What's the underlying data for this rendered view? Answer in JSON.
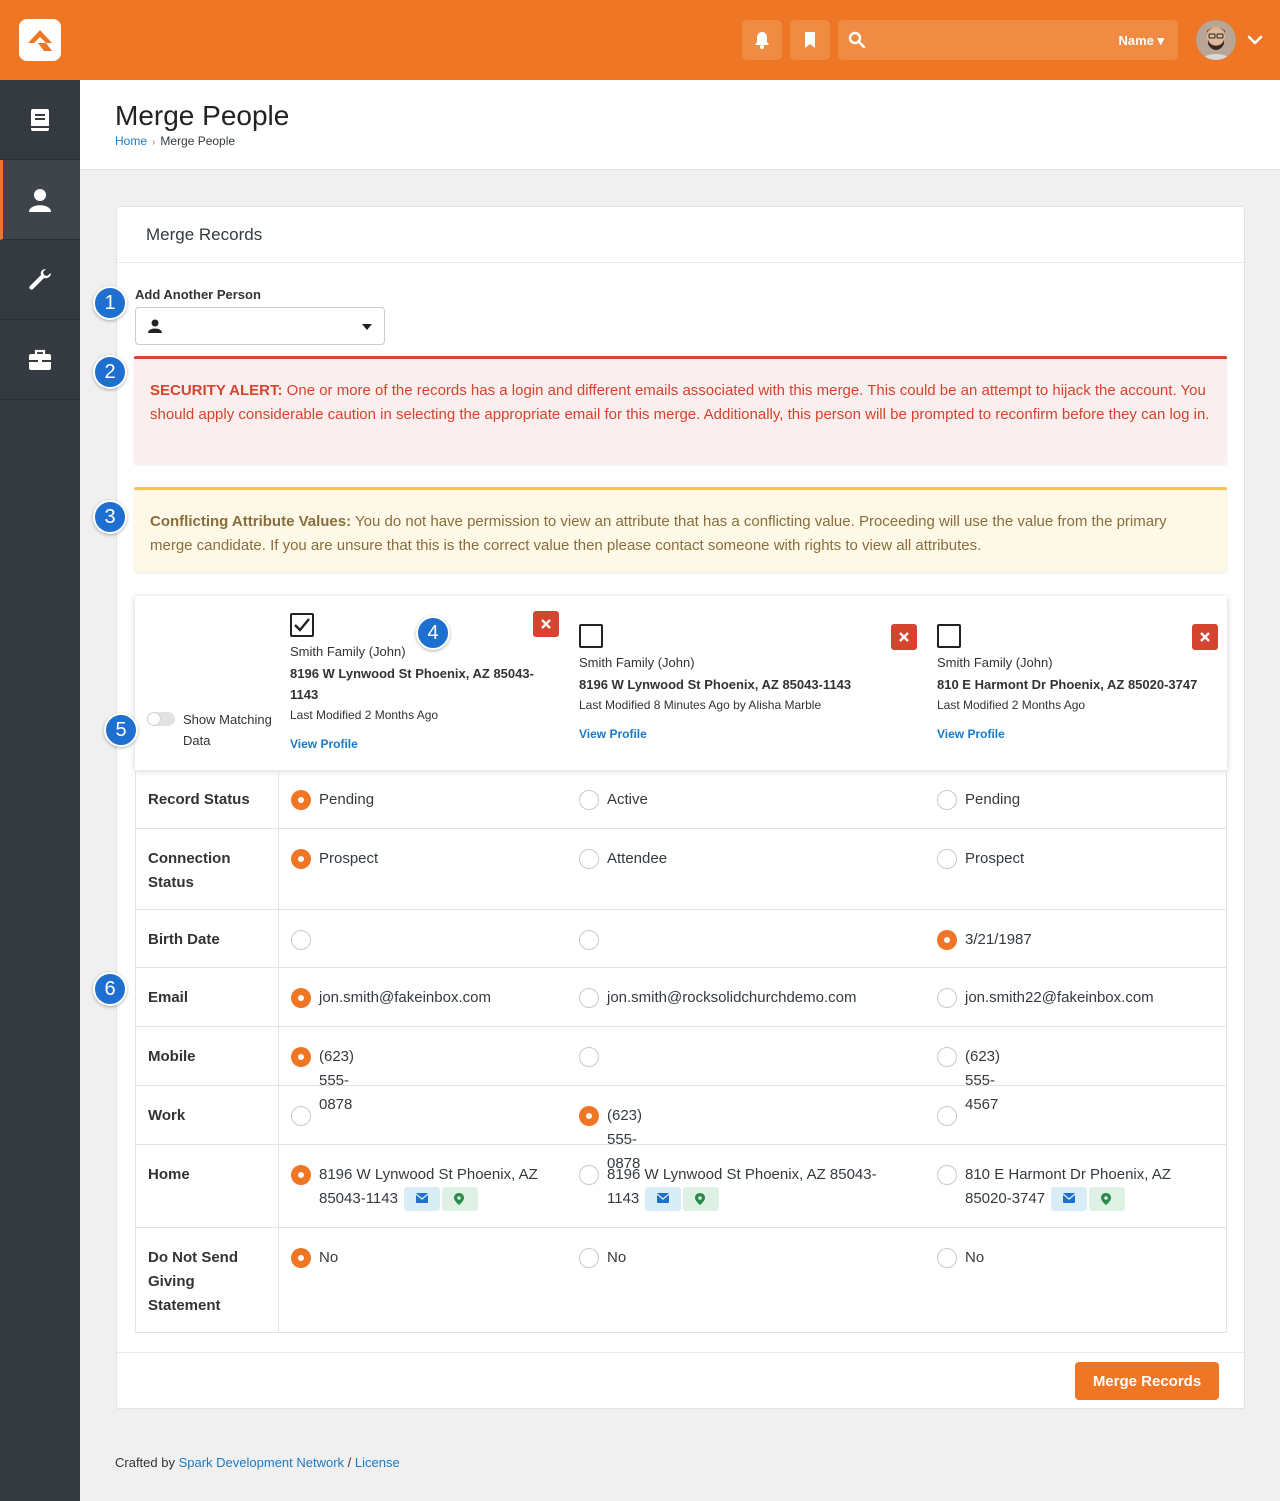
{
  "header": {
    "search_placeholder": "",
    "search_scope": "Name ▾"
  },
  "page": {
    "title": "Merge People",
    "breadcrumb": {
      "home": "Home",
      "separator": "›",
      "current": "Merge People"
    }
  },
  "panel": {
    "title": "Merge Records",
    "add_person_label": "Add Another Person",
    "security_alert": {
      "heading": "SECURITY ALERT:",
      "text": " One or more of the records has a login and different emails associated with this merge. This could be an attempt to hijack the account. You should apply considerable caution in selecting the appropriate email for this merge. Additionally, this person will be prompted to reconfirm before they can log in."
    },
    "conflict_alert": {
      "heading": "Conflicting Attribute Values:",
      "text": " You do not have permission to view an attribute that has a conflicting value. Proceeding will use the value from the primary merge candidate. If you are unsure that this is the correct value then please contact someone with rights to view all attributes."
    },
    "toggle_label": "Show Matching Data",
    "candidates": [
      {
        "checked": true,
        "name": "Smith Family (John)",
        "address": "8196 W Lynwood St Phoenix, AZ 85043-1143",
        "modified": "Last Modified 2 Months Ago",
        "view_profile": "View Profile"
      },
      {
        "checked": false,
        "name": "Smith Family (John)",
        "address": "8196 W Lynwood St Phoenix, AZ 85043-1143",
        "modified": "Last Modified 8 Minutes Ago by Alisha Marble",
        "view_profile": "View Profile"
      },
      {
        "checked": false,
        "name": "Smith Family (John)",
        "address": "810 E Harmont Dr Phoenix, AZ 85020-3747",
        "modified": "Last Modified 2 Months Ago",
        "view_profile": "View Profile"
      }
    ],
    "rows": [
      {
        "label": "Record Status",
        "values": [
          "Pending",
          "Active",
          "Pending"
        ],
        "selected": 0
      },
      {
        "label": "Connection Status",
        "values": [
          "Prospect",
          "Attendee",
          "Prospect"
        ],
        "selected": 0
      },
      {
        "label": "Birth Date",
        "values": [
          "",
          "",
          "3/21/1987"
        ],
        "selected": 2
      },
      {
        "label": "Email",
        "values": [
          "jon.smith@fakeinbox.com",
          "jon.smith@rocksolidchurchdemo.com",
          "jon.smith22@fakeinbox.com"
        ],
        "selected": 0
      },
      {
        "label": "Mobile",
        "values": [
          "(623) 555-0878",
          "",
          "(623) 555-4567"
        ],
        "selected": 0
      },
      {
        "label": "Work",
        "values": [
          "",
          "(623) 555-0878",
          ""
        ],
        "selected": 1
      },
      {
        "label": "Home",
        "values": [
          "8196 W Lynwood St Phoenix, AZ 85043-1143",
          "8196 W Lynwood St Phoenix, AZ 85043-1143",
          "810 E Harmont Dr Phoenix, AZ 85020-3747"
        ],
        "selected": 0
      },
      {
        "label": "Do Not Send Giving Statement",
        "values": [
          "No",
          "No",
          "No"
        ],
        "selected": 0
      }
    ],
    "merge_button": "Merge Records"
  },
  "callouts": [
    "1",
    "2",
    "3",
    "4",
    "5",
    "6"
  ],
  "footer": {
    "prefix": "Crafted by ",
    "link1": "Spark Development Network",
    "divider": " / ",
    "link2": "License"
  },
  "colors": {
    "brand": "#ee7624",
    "danger": "#d4442f",
    "warning": "#f5c64e",
    "link": "#1a7ac7",
    "sidebar": "#343a40",
    "callout": "#1e6fd0"
  }
}
